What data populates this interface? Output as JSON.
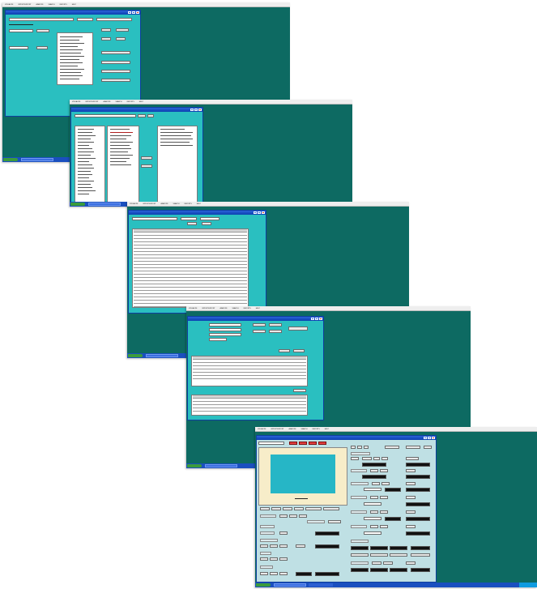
{
  "screenshots": [
    {
      "name": "screen-1-lookup",
      "menubar": [
        "VISUALIZE",
        "IMPORT/EXPORT",
        "ANALYZE",
        "SEARCH",
        "REPORTS",
        "HELP"
      ],
      "window_title": ""
    },
    {
      "name": "screen-2-selection",
      "menubar": [
        "VISUALIZE",
        "IMPORT/EXPORT",
        "ANALYZE",
        "SEARCH",
        "REPORTS",
        "HELP"
      ],
      "window_title": ""
    },
    {
      "name": "screen-3-table",
      "menubar": [
        "VISUALIZE",
        "IMPORT/EXPORT",
        "ANALYZE",
        "SEARCH",
        "REPORTS",
        "HELP"
      ],
      "window_title": ""
    },
    {
      "name": "screen-4-records",
      "menubar": [
        "VISUALIZE",
        "IMPORT/EXPORT",
        "ANALYZE",
        "SEARCH",
        "REPORTS",
        "HELP"
      ],
      "window_title": ""
    },
    {
      "name": "screen-5-control-panel",
      "menubar": [
        "VISUALIZE",
        "IMPORT/EXPORT",
        "ANALYZE",
        "SEARCH",
        "REPORTS",
        "HELP"
      ],
      "window_title": ""
    }
  ],
  "colors": {
    "desktop": "#0d6a62",
    "window_body": "#2abfc0",
    "titlebar": "#1f55cc",
    "taskbar": "#1a4fbf",
    "panel_body": "#bfe0e4",
    "chart_bg": "#f7edc9",
    "chart_plot": "#26b6c6",
    "alert_button": "#e34040"
  },
  "icons": [
    "minimize-icon",
    "maximize-icon",
    "close-icon",
    "start-button-icon"
  ]
}
